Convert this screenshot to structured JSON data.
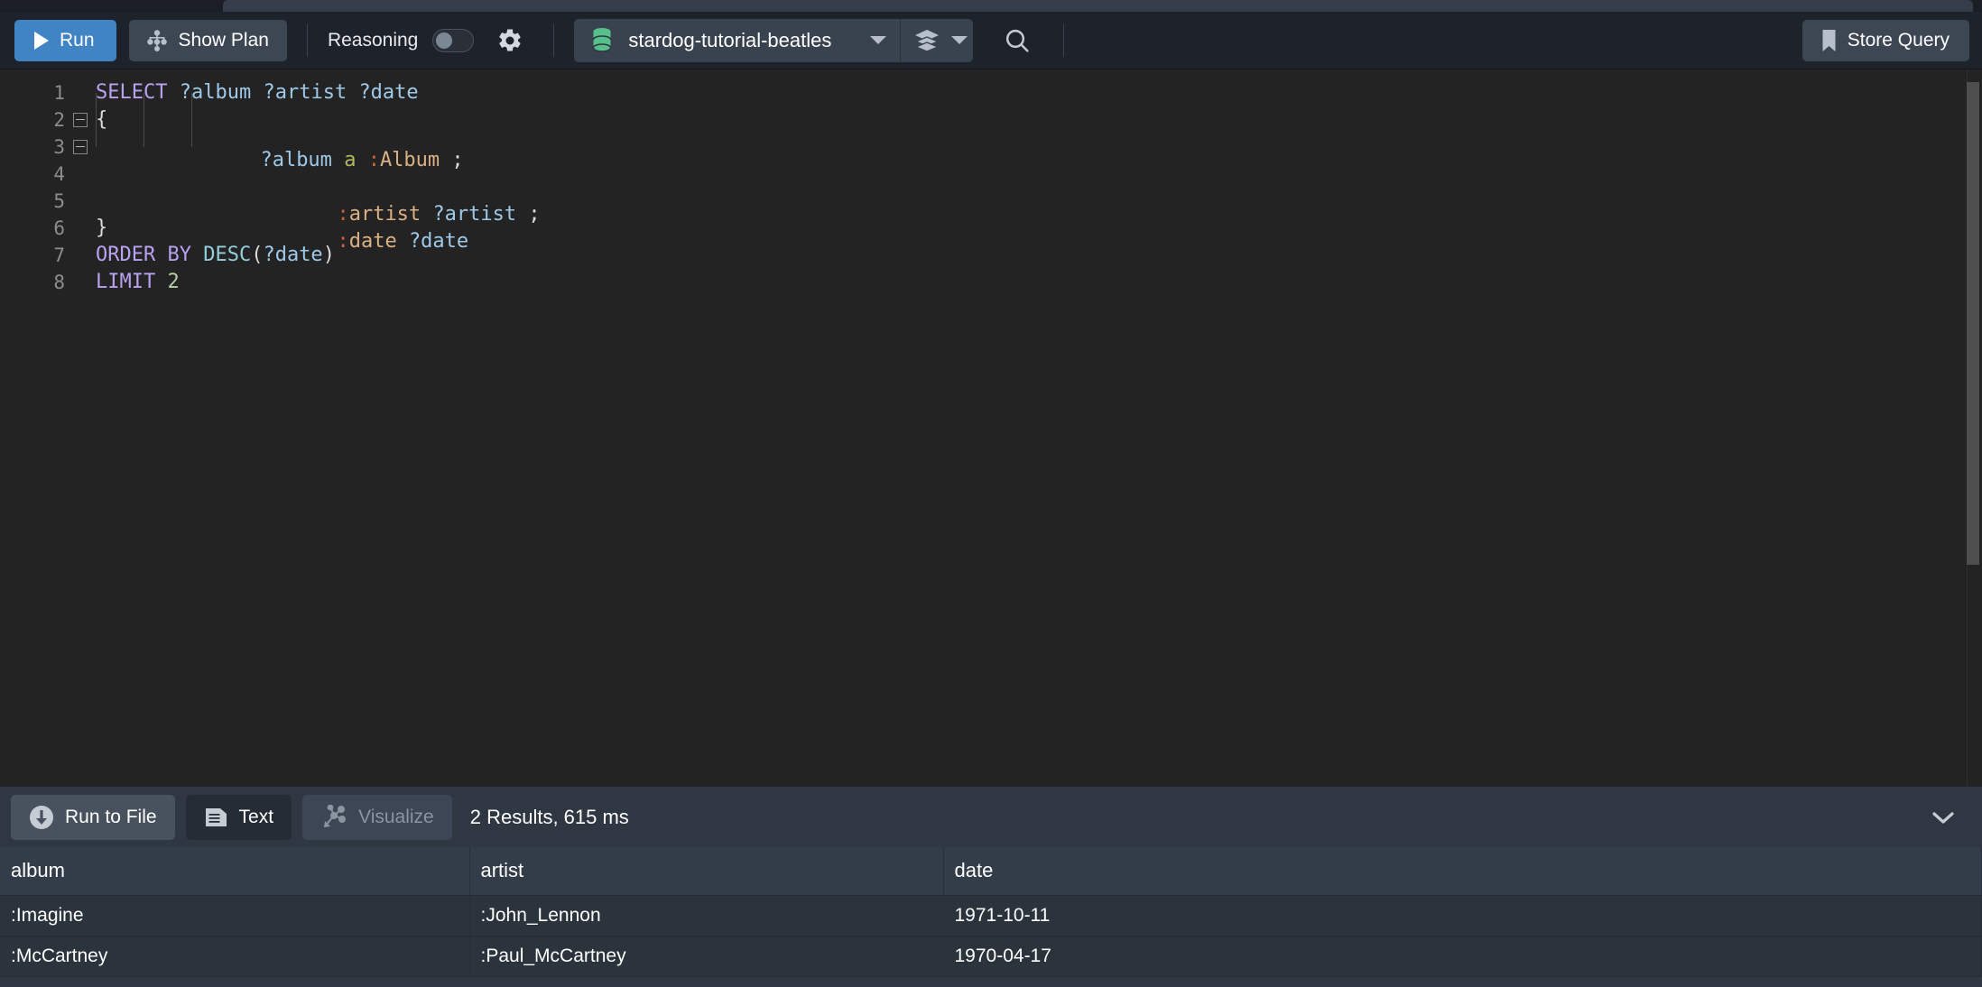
{
  "app": {
    "title": "Stardog Studio Query Editor"
  },
  "toolbar": {
    "run_label": "Run",
    "run_icon": "play-icon",
    "show_plan_label": "Show Plan",
    "show_plan_icon": "plan-tree-icon",
    "reasoning_label": "Reasoning",
    "reasoning_toggle_state": "off",
    "settings_icon": "gear-icon",
    "database_icon": "database-icon",
    "database_name": "stardog-tutorial-beatles",
    "database_caret_icon": "caret-down-icon",
    "graph_icon": "layers-icon",
    "graph_caret_icon": "caret-down-icon",
    "search_icon": "search-icon",
    "store_query_label": "Store Query",
    "store_query_icon": "bookmark-icon",
    "accent_color": "#4084c4",
    "button_bg_color": "#3c4753"
  },
  "editor": {
    "language": "SPARQL",
    "lines": [
      {
        "n": "1",
        "fold": false,
        "guides": 0
      },
      {
        "n": "2",
        "fold": true,
        "guides": 0
      },
      {
        "n": "3",
        "fold": true,
        "guides": 1
      },
      {
        "n": "4",
        "fold": false,
        "guides": 3
      },
      {
        "n": "5",
        "fold": false,
        "guides": 3
      },
      {
        "n": "6",
        "fold": false,
        "guides": 1
      },
      {
        "n": "7",
        "fold": false,
        "guides": 0
      },
      {
        "n": "8",
        "fold": false,
        "guides": 0
      }
    ],
    "code": [
      "SELECT ?album ?artist ?date",
      "{",
      "    ?album a :Album ;",
      "           :artist ?artist ;",
      "           :date ?date",
      "}",
      "ORDER BY DESC(?date)",
      "LIMIT 2"
    ],
    "tokens": {
      "l1": {
        "kw": "SELECT",
        "v1": "?album",
        "v2": "?artist",
        "v3": "?date"
      },
      "l2": {
        "brace": "{"
      },
      "l3": {
        "var": "?album",
        "a": "a",
        "colon": ":",
        "local": "Album",
        "semi": ";"
      },
      "l4": {
        "colon": ":",
        "local": "artist",
        "var": "?artist",
        "semi": ";"
      },
      "l5": {
        "colon": ":",
        "local": "date",
        "var": "?date"
      },
      "l6": {
        "brace": "}"
      },
      "l7": {
        "kw": "ORDER BY",
        "fn": "DESC",
        "open": "(",
        "var": "?date",
        "close": ")"
      },
      "l8": {
        "kw": "LIMIT",
        "num": "2"
      }
    }
  },
  "results": {
    "run_to_file_label": "Run to File",
    "run_to_file_icon": "download-circle-icon",
    "text_label": "Text",
    "text_icon": "document-icon",
    "visualize_label": "Visualize",
    "visualize_icon": "graph-nodes-icon",
    "visualize_disabled": true,
    "summary": "2 Results,  615 ms",
    "result_count": 2,
    "duration_ms": 615,
    "collapse_icon": "chevron-down-icon",
    "columns": [
      "album",
      "artist",
      "date"
    ],
    "rows": [
      {
        "album": ":Imagine",
        "artist": ":John_Lennon",
        "date": "1971-10-11"
      },
      {
        "album": ":McCartney",
        "artist": ":Paul_McCartney",
        "date": "1970-04-17"
      }
    ]
  }
}
